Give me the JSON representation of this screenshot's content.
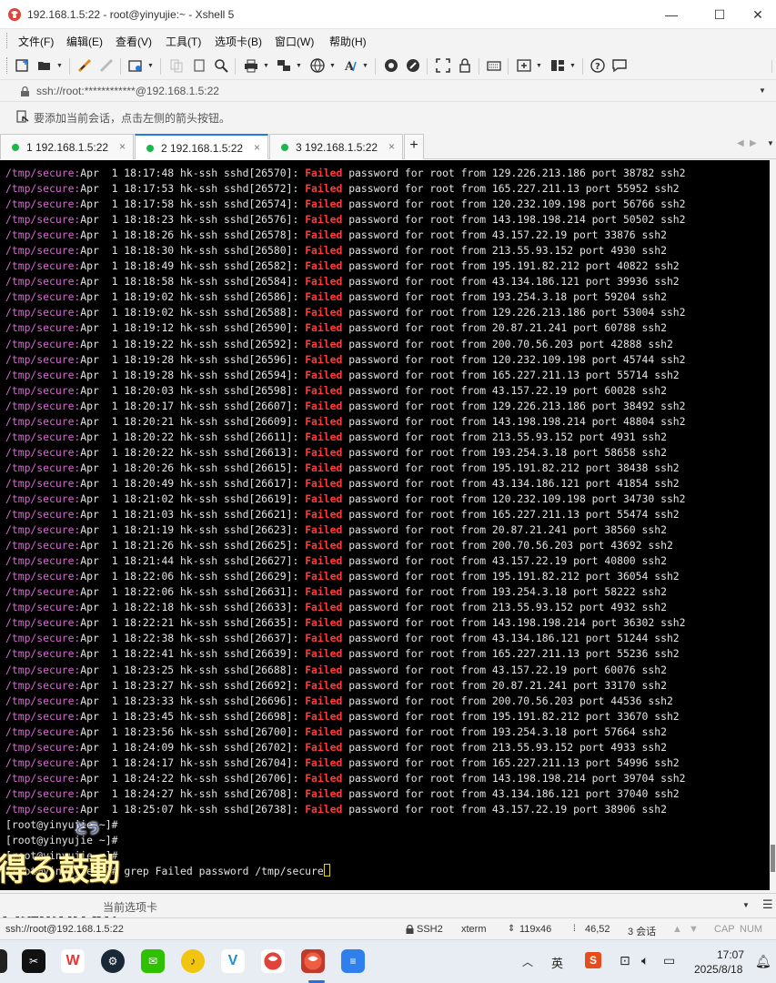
{
  "window": {
    "title": "192.168.1.5:22 - root@yinyujie:~ - Xshell 5",
    "minimize": "—",
    "maximize": "☐",
    "close": "✕"
  },
  "menu": [
    "文件(F)",
    "编辑(E)",
    "查看(V)",
    "工具(T)",
    "选项卡(B)",
    "窗口(W)",
    "帮助(H)"
  ],
  "address": "ssh://root:************@192.168.1.5:22",
  "hint": "要添加当前会话，点击左侧的箭头按钮。",
  "tabs": [
    {
      "label": "1 192.168.1.5:22",
      "active": false
    },
    {
      "label": "2 192.168.1.5:22",
      "active": true
    },
    {
      "label": "3 192.168.1.5:22",
      "active": false
    }
  ],
  "tab_new": "+",
  "tab_close": "×",
  "terminal": {
    "path_prefix": "/tmp/secure:",
    "failed_word": "Failed",
    "log_lines": [
      {
        "ts": "Apr  1 18:17:48",
        "pid": "26570",
        "ip": "129.226.213.186",
        "port": "38782"
      },
      {
        "ts": "Apr  1 18:17:53",
        "pid": "26572",
        "ip": "165.227.211.13",
        "port": "55952"
      },
      {
        "ts": "Apr  1 18:17:58",
        "pid": "26574",
        "ip": "120.232.109.198",
        "port": "56766"
      },
      {
        "ts": "Apr  1 18:18:23",
        "pid": "26576",
        "ip": "143.198.198.214",
        "port": "50502"
      },
      {
        "ts": "Apr  1 18:18:26",
        "pid": "26578",
        "ip": "43.157.22.19",
        "port": "33876"
      },
      {
        "ts": "Apr  1 18:18:30",
        "pid": "26580",
        "ip": "213.55.93.152",
        "port": "4930"
      },
      {
        "ts": "Apr  1 18:18:49",
        "pid": "26582",
        "ip": "195.191.82.212",
        "port": "40822"
      },
      {
        "ts": "Apr  1 18:18:58",
        "pid": "26584",
        "ip": "43.134.186.121",
        "port": "39936"
      },
      {
        "ts": "Apr  1 18:19:02",
        "pid": "26586",
        "ip": "193.254.3.18",
        "port": "59204"
      },
      {
        "ts": "Apr  1 18:19:02",
        "pid": "26588",
        "ip": "129.226.213.186",
        "port": "53004"
      },
      {
        "ts": "Apr  1 18:19:12",
        "pid": "26590",
        "ip": "20.87.21.241",
        "port": "60788"
      },
      {
        "ts": "Apr  1 18:19:22",
        "pid": "26592",
        "ip": "200.70.56.203",
        "port": "42888"
      },
      {
        "ts": "Apr  1 18:19:28",
        "pid": "26596",
        "ip": "120.232.109.198",
        "port": "45744"
      },
      {
        "ts": "Apr  1 18:19:28",
        "pid": "26594",
        "ip": "165.227.211.13",
        "port": "55714"
      },
      {
        "ts": "Apr  1 18:20:03",
        "pid": "26598",
        "ip": "43.157.22.19",
        "port": "60028"
      },
      {
        "ts": "Apr  1 18:20:17",
        "pid": "26607",
        "ip": "129.226.213.186",
        "port": "38492"
      },
      {
        "ts": "Apr  1 18:20:21",
        "pid": "26609",
        "ip": "143.198.198.214",
        "port": "48804"
      },
      {
        "ts": "Apr  1 18:20:22",
        "pid": "26611",
        "ip": "213.55.93.152",
        "port": "4931"
      },
      {
        "ts": "Apr  1 18:20:22",
        "pid": "26613",
        "ip": "193.254.3.18",
        "port": "58658"
      },
      {
        "ts": "Apr  1 18:20:26",
        "pid": "26615",
        "ip": "195.191.82.212",
        "port": "38438"
      },
      {
        "ts": "Apr  1 18:20:49",
        "pid": "26617",
        "ip": "43.134.186.121",
        "port": "41854"
      },
      {
        "ts": "Apr  1 18:21:02",
        "pid": "26619",
        "ip": "120.232.109.198",
        "port": "34730"
      },
      {
        "ts": "Apr  1 18:21:03",
        "pid": "26621",
        "ip": "165.227.211.13",
        "port": "55474"
      },
      {
        "ts": "Apr  1 18:21:19",
        "pid": "26623",
        "ip": "20.87.21.241",
        "port": "38560"
      },
      {
        "ts": "Apr  1 18:21:26",
        "pid": "26625",
        "ip": "200.70.56.203",
        "port": "43692"
      },
      {
        "ts": "Apr  1 18:21:44",
        "pid": "26627",
        "ip": "43.157.22.19",
        "port": "40800"
      },
      {
        "ts": "Apr  1 18:22:06",
        "pid": "26629",
        "ip": "195.191.82.212",
        "port": "36054"
      },
      {
        "ts": "Apr  1 18:22:06",
        "pid": "26631",
        "ip": "193.254.3.18",
        "port": "58222"
      },
      {
        "ts": "Apr  1 18:22:18",
        "pid": "26633",
        "ip": "213.55.93.152",
        "port": "4932"
      },
      {
        "ts": "Apr  1 18:22:21",
        "pid": "26635",
        "ip": "143.198.198.214",
        "port": "36302"
      },
      {
        "ts": "Apr  1 18:22:38",
        "pid": "26637",
        "ip": "43.134.186.121",
        "port": "51244"
      },
      {
        "ts": "Apr  1 18:22:41",
        "pid": "26639",
        "ip": "165.227.211.13",
        "port": "55236"
      },
      {
        "ts": "Apr  1 18:23:25",
        "pid": "26688",
        "ip": "43.157.22.19",
        "port": "60076"
      },
      {
        "ts": "Apr  1 18:23:27",
        "pid": "26692",
        "ip": "20.87.21.241",
        "port": "33170"
      },
      {
        "ts": "Apr  1 18:23:33",
        "pid": "26696",
        "ip": "200.70.56.203",
        "port": "44536"
      },
      {
        "ts": "Apr  1 18:23:45",
        "pid": "26698",
        "ip": "195.191.82.212",
        "port": "33670"
      },
      {
        "ts": "Apr  1 18:23:56",
        "pid": "26700",
        "ip": "193.254.3.18",
        "port": "57664"
      },
      {
        "ts": "Apr  1 18:24:09",
        "pid": "26702",
        "ip": "213.55.93.152",
        "port": "4933"
      },
      {
        "ts": "Apr  1 18:24:17",
        "pid": "26704",
        "ip": "165.227.211.13",
        "port": "54996"
      },
      {
        "ts": "Apr  1 18:24:22",
        "pid": "26706",
        "ip": "143.198.198.214",
        "port": "39704"
      },
      {
        "ts": "Apr  1 18:24:27",
        "pid": "26708",
        "ip": "43.134.186.121",
        "port": "37040"
      },
      {
        "ts": "Apr  1 18:25:07",
        "pid": "26738",
        "ip": "43.157.22.19",
        "port": "38906"
      }
    ],
    "prompt_lines": [
      "[root@yinyujie ~]#",
      "[root@yinyujie ~]#",
      "[root@yinyujie ~]#"
    ],
    "last_prompt": "[root@yinyujie ~]#",
    "command": "grep Failed password /tmp/secure"
  },
  "overlay": {
    "line1": "得る鼓動",
    "line2": "心跳加速",
    "small": "とう"
  },
  "sendbar_text": "当前选项卡",
  "status": {
    "session": "ssh://root@192.168.1.5:22",
    "protocol": "SSH2",
    "term": "xterm",
    "size": "119x46",
    "cursor": "46,52",
    "sessions": "3 会话",
    "caps": "CAP",
    "num": "NUM"
  },
  "taskbar": {
    "ime1": "英",
    "ime2": "S",
    "time": "17:07",
    "date": "2025/8/18"
  }
}
